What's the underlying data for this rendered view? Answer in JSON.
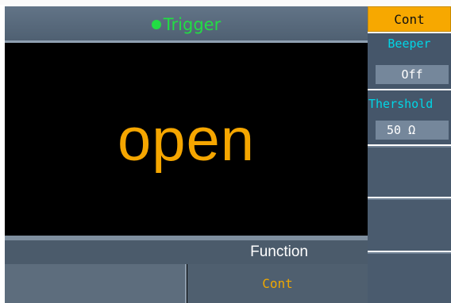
{
  "header": {
    "title": "Trigger"
  },
  "status": {
    "text": "open"
  },
  "function_bar": {
    "label": "Function",
    "buttons": [
      "",
      "Cont"
    ]
  },
  "softkeys": {
    "mode": "Cont",
    "beeper": {
      "title": "Beeper",
      "value": "Off"
    },
    "threshold": {
      "title": "Thershold",
      "value": "50 Ω"
    }
  },
  "colors": {
    "accent": "#f5a600",
    "trigger": "#22dd44",
    "cyan": "#00d6e6"
  }
}
